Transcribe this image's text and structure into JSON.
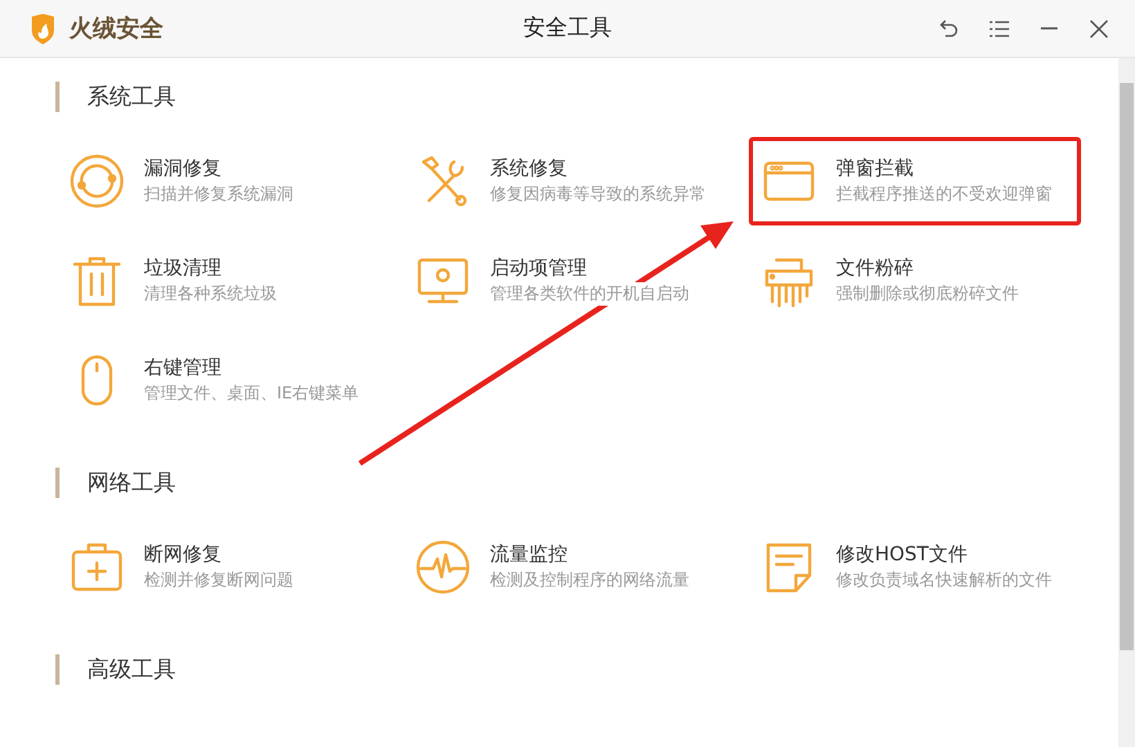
{
  "app": {
    "brand": "火绒安全",
    "title": "安全工具"
  },
  "sections": [
    {
      "title": "系统工具",
      "tools": [
        {
          "name": "漏洞修复",
          "desc": "扫描并修复系统漏洞",
          "highlighted": false
        },
        {
          "name": "系统修复",
          "desc": "修复因病毒等导致的系统异常",
          "highlighted": false
        },
        {
          "name": "弹窗拦截",
          "desc": "拦截程序推送的不受欢迎弹窗",
          "highlighted": true
        },
        {
          "name": "垃圾清理",
          "desc": "清理各种系统垃圾",
          "highlighted": false
        },
        {
          "name": "启动项管理",
          "desc": "管理各类软件的开机自启动",
          "highlighted": false
        },
        {
          "name": "文件粉碎",
          "desc": "强制删除或彻底粉碎文件",
          "highlighted": false
        },
        {
          "name": "右键管理",
          "desc": "管理文件、桌面、IE右键菜单",
          "highlighted": false
        }
      ]
    },
    {
      "title": "网络工具",
      "tools": [
        {
          "name": "断网修复",
          "desc": "检测并修复断网问题",
          "highlighted": false
        },
        {
          "name": "流量监控",
          "desc": "检测及控制程序的网络流量",
          "highlighted": false
        },
        {
          "name": "修改HOST文件",
          "desc": "修改负责域名快速解析的文件",
          "highlighted": false
        }
      ]
    },
    {
      "title": "高级工具"
    }
  ]
}
